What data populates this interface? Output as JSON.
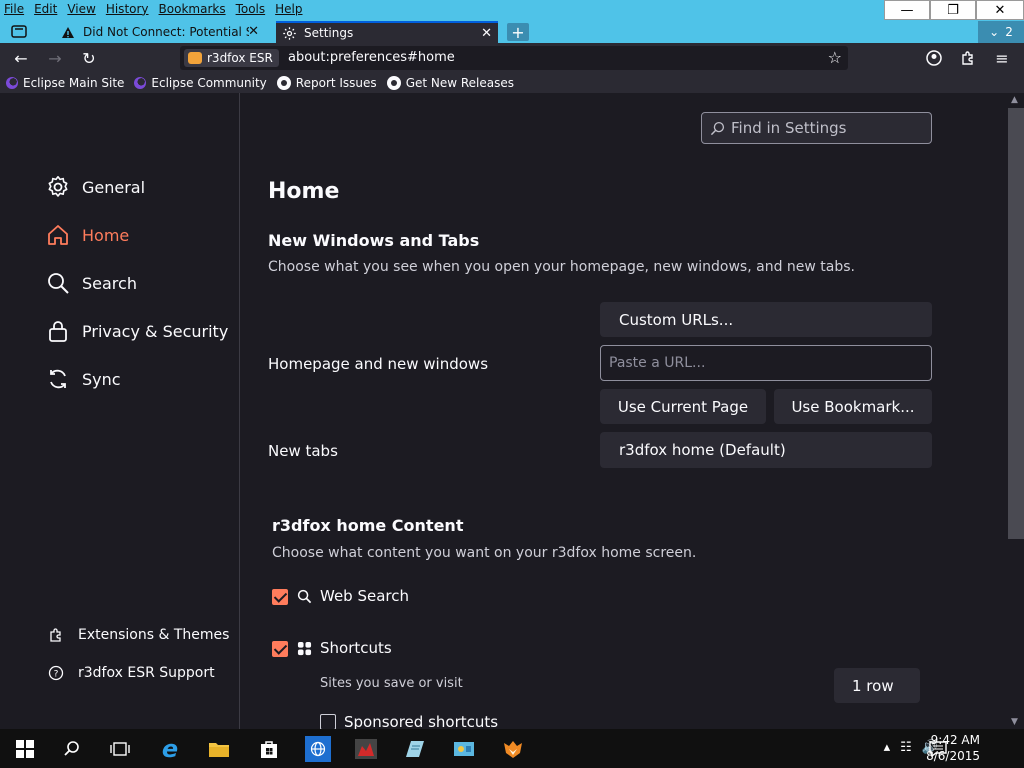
{
  "colors": {
    "accent": "#ff7c5c",
    "titlebar": "#4fc3e8",
    "content_bg": "#1c1b22",
    "chrome_bg": "#2b2a33"
  },
  "menubar": {
    "items": [
      "File",
      "Edit",
      "View",
      "History",
      "Bookmarks",
      "Tools",
      "Help"
    ]
  },
  "tabs": [
    {
      "label": "Did Not Connect: Potential Secu",
      "icon": "warning-icon"
    },
    {
      "label": "Settings",
      "icon": "gear-icon"
    }
  ],
  "tab_count": "2",
  "navbar": {
    "identity_label": "r3dfox ESR",
    "url": "about:preferences#home"
  },
  "bookmarks": [
    {
      "label": "Eclipse Main Site",
      "icon": "eclipse-icon"
    },
    {
      "label": "Eclipse Community",
      "icon": "eclipse-icon"
    },
    {
      "label": "Report Issues",
      "icon": "github-icon"
    },
    {
      "label": "Get New Releases",
      "icon": "github-icon"
    }
  ],
  "sidebar": {
    "categories": [
      {
        "label": "General",
        "icon": "gear-icon"
      },
      {
        "label": "Home",
        "icon": "home-icon",
        "active": true
      },
      {
        "label": "Search",
        "icon": "search-icon"
      },
      {
        "label": "Privacy & Security",
        "icon": "lock-icon"
      },
      {
        "label": "Sync",
        "icon": "sync-icon"
      }
    ],
    "footer": [
      {
        "label": "Extensions & Themes",
        "icon": "puzzle-icon"
      },
      {
        "label": "r3dfox ESR Support",
        "icon": "help-icon"
      }
    ]
  },
  "main": {
    "search_placeholder": "Find in Settings",
    "title": "Home",
    "new_windows": {
      "heading": "New Windows and Tabs",
      "description": "Choose what you see when you open your homepage, new windows, and new tabs.",
      "homepage_label": "Homepage and new windows",
      "homepage_select": "Custom URLs...",
      "url_placeholder": "Paste a URL...",
      "use_current_page": "Use Current Page",
      "use_bookmark": "Use Bookmark...",
      "newtabs_label": "New tabs",
      "newtabs_select": "r3dfox home (Default)"
    },
    "home_content": {
      "heading": "r3dfox home Content",
      "description": "Choose what content you want on your r3dfox home screen.",
      "web_search": {
        "label": "Web Search",
        "checked": true
      },
      "shortcuts": {
        "label": "Shortcuts",
        "checked": true,
        "description": "Sites you save or visit",
        "rows": "1 row"
      },
      "sponsored": {
        "label": "Sponsored shortcuts",
        "checked": false
      }
    }
  },
  "taskbar": {
    "time": "9:42 AM",
    "date": "8/6/2015"
  }
}
